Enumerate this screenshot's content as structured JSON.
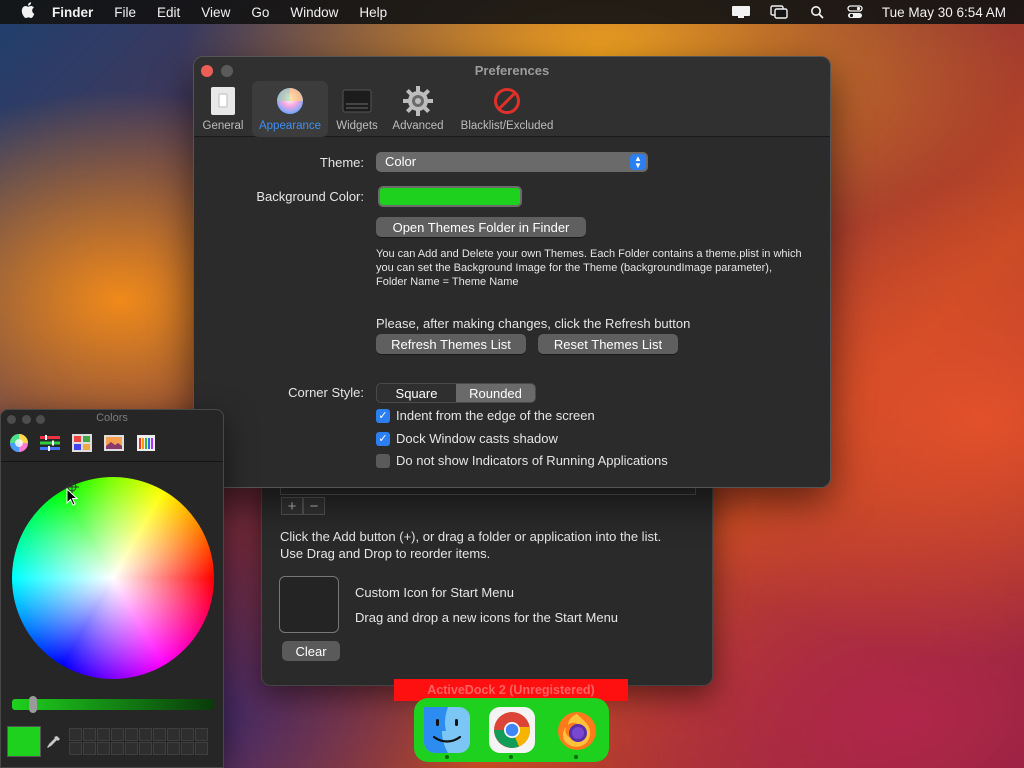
{
  "menubar": {
    "app_name": "Finder",
    "items": [
      "File",
      "Edit",
      "View",
      "Go",
      "Window",
      "Help"
    ],
    "clock": "Tue May 30  6:54 AM"
  },
  "prefs": {
    "title": "Preferences",
    "toolbar": [
      "General",
      "Appearance",
      "Widgets",
      "Advanced",
      "Blacklist/Excluded"
    ],
    "active_tab": "Appearance",
    "theme_label": "Theme:",
    "theme_value": "Color",
    "bg_color_label": "Background Color:",
    "bg_color": "#1ed11e",
    "open_themes_button": "Open Themes Folder in Finder",
    "info_text": "You can Add and Delete  your own Themes. Each Folder contains a theme.plist in which you can set the Background Image for the Theme (backgroundImage parameter), Folder Name = Theme Name",
    "refresh_note": "Please, after making changes, click the Refresh button",
    "refresh_button": "Refresh Themes List",
    "reset_button": "Reset Themes List",
    "corner_label": "Corner Style:",
    "corner_options": [
      "Square",
      "Rounded"
    ],
    "corner_selected": "Rounded",
    "checkboxes": [
      {
        "label": "Indent from the edge of the screen",
        "checked": true
      },
      {
        "label": "Dock Window casts shadow",
        "checked": true
      },
      {
        "label": "Do not show Indicators of Running Applications",
        "checked": false
      }
    ]
  },
  "back_window": {
    "add_symbol": "+",
    "remove_symbol": "−",
    "hint_line1": "Click the Add button (+), or drag a folder or application into the list.",
    "hint_line2": "Use Drag and Drop to reorder items.",
    "custom_icon_title": "Custom Icon for Start Menu",
    "custom_icon_desc": "Drag and drop a new icons for the Start Menu",
    "clear_button": "Clear"
  },
  "colors_panel": {
    "title": "Colors",
    "current_color": "#1ed11e"
  },
  "dock": {
    "label": "ActiveDock 2 (Unregistered)",
    "apps": [
      "finder-icon",
      "chrome-icon",
      "firefox-icon"
    ],
    "color": "#1ed11e"
  }
}
